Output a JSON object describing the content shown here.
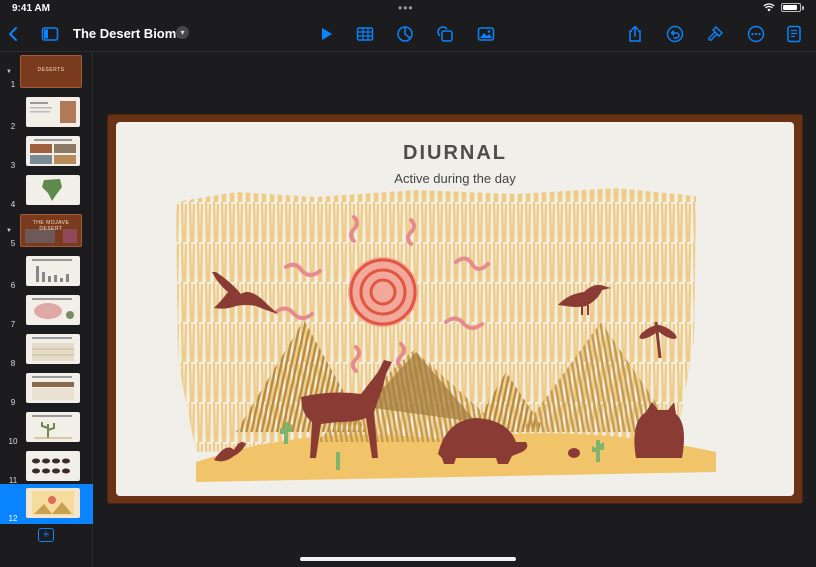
{
  "status": {
    "time": "9:41 AM",
    "dots": "•••"
  },
  "toolbar": {
    "title": "The Desert Biome",
    "icons": [
      "back-chevron-icon",
      "sidebar-icon",
      "play-icon",
      "table-icon",
      "chart-icon",
      "shapes-icon",
      "media-icon",
      "share-icon",
      "undo-icon",
      "format-brush-icon",
      "more-icon",
      "document-icon"
    ],
    "accent": "#0a84ff"
  },
  "navigator": {
    "slides": [
      {
        "num": "1",
        "label": "DESERTS",
        "type": "section"
      },
      {
        "num": "2",
        "type": "child"
      },
      {
        "num": "3",
        "type": "child"
      },
      {
        "num": "4",
        "type": "child"
      },
      {
        "num": "5",
        "label": "THE MOJAVE DESERT",
        "type": "section"
      },
      {
        "num": "6",
        "type": "child"
      },
      {
        "num": "7",
        "type": "child"
      },
      {
        "num": "8",
        "type": "child"
      },
      {
        "num": "9",
        "type": "child"
      },
      {
        "num": "10",
        "type": "child"
      },
      {
        "num": "11",
        "type": "child"
      },
      {
        "num": "12",
        "type": "child",
        "selected": true
      }
    ],
    "add_slide_label": "+"
  },
  "slide": {
    "title": "DIURNAL",
    "subtitle": "Active during the day",
    "frame_color": "#6b3316",
    "background": "#f1efea"
  }
}
